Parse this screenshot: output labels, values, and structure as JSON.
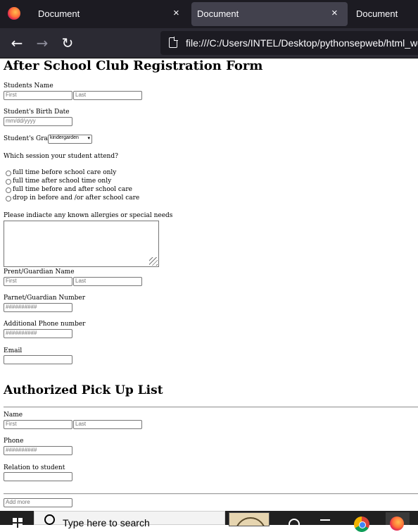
{
  "browser": {
    "tabs": [
      {
        "label": "Document",
        "active": false,
        "closable": true
      },
      {
        "label": "Document",
        "active": true,
        "closable": true
      },
      {
        "label": "Document",
        "active": false,
        "closable": false
      }
    ],
    "close_glyph": "×",
    "url": "file:///C:/Users/INTEL/Desktop/pythonsepweb/html_wo",
    "nav": {
      "back_glyph": "←",
      "forward_glyph": "→",
      "reload_glyph": "↻"
    }
  },
  "form": {
    "title": "After School Club Registration Form",
    "student_name": {
      "label": "Students Name",
      "first_placeholder": "First",
      "last_placeholder": "Last"
    },
    "birth_date": {
      "label": "Student's Birth Date",
      "placeholder": "mm/dd/yyyy"
    },
    "grade": {
      "label": "Student's Grade",
      "selected": "kindergarden"
    },
    "session": {
      "question": "Which session your student attend?",
      "options": [
        "full time before school care only",
        "full time after school time only",
        "full time before and after school care",
        "drop in before and /or after school care"
      ]
    },
    "allergies": {
      "label": "Please indiacte any known allergies or special needs"
    },
    "guardian_name": {
      "label": "Prent/Guardian Name",
      "first_placeholder": "First",
      "last_placeholder": "Last"
    },
    "guardian_number": {
      "label": "Parnet/Guardian Number",
      "placeholder": "##########"
    },
    "additional_phone": {
      "label": "Additional Phone number",
      "placeholder": "##########"
    },
    "email": {
      "label": "Email"
    }
  },
  "pickup": {
    "title": "Authorized Pick Up List",
    "name": {
      "label": "Name",
      "first_placeholder": "First",
      "last_placeholder": "Last"
    },
    "phone": {
      "label": "Phone",
      "placeholder": "##########"
    },
    "relation": {
      "label": "Relation to student"
    },
    "add_more_placeholder": "Add more"
  },
  "taskbar": {
    "search_placeholder": "Type here to search"
  }
}
